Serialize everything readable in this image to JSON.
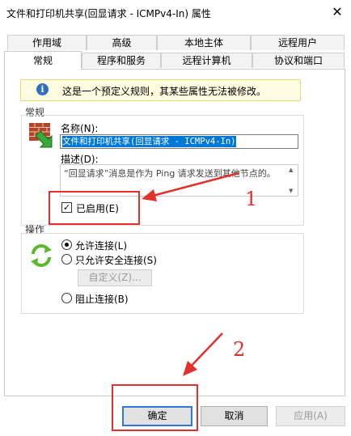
{
  "window": {
    "title": "文件和打印机共享(回显请求 - ICMPv4-In) 属性",
    "close_glyph": "✕"
  },
  "tabs_row1": [
    "作用域",
    "高级",
    "本地主体",
    "远程用户"
  ],
  "tabs_row2": [
    "常规",
    "程序和服务",
    "远程计算机",
    "协议和端口"
  ],
  "info_banner": {
    "icon": "i",
    "text": "这是一个预定义规则，其某些属性无法被修改。"
  },
  "general": {
    "group_label": "常规",
    "name_label": "名称(N):",
    "name_value": "文件和打印机共享(回显请求 - ICMPv4-In)",
    "desc_label": "描述(D):",
    "desc_value": "“回显请求”消息是作为 Ping 请求发送到其他节点的。",
    "enabled_label": "已启用(E)",
    "enabled_checked": "✓"
  },
  "action": {
    "group_label": "操作",
    "allow_label": "允许连接(L)",
    "allow_secure_label": "只允许安全连接(S)",
    "customize_label": "自定义(Z)...",
    "block_label": "阻止连接(B)"
  },
  "annotations": {
    "one": "1",
    "two": "2"
  },
  "buttons": {
    "ok": "确定",
    "cancel": "取消",
    "apply": "应用(A)"
  }
}
